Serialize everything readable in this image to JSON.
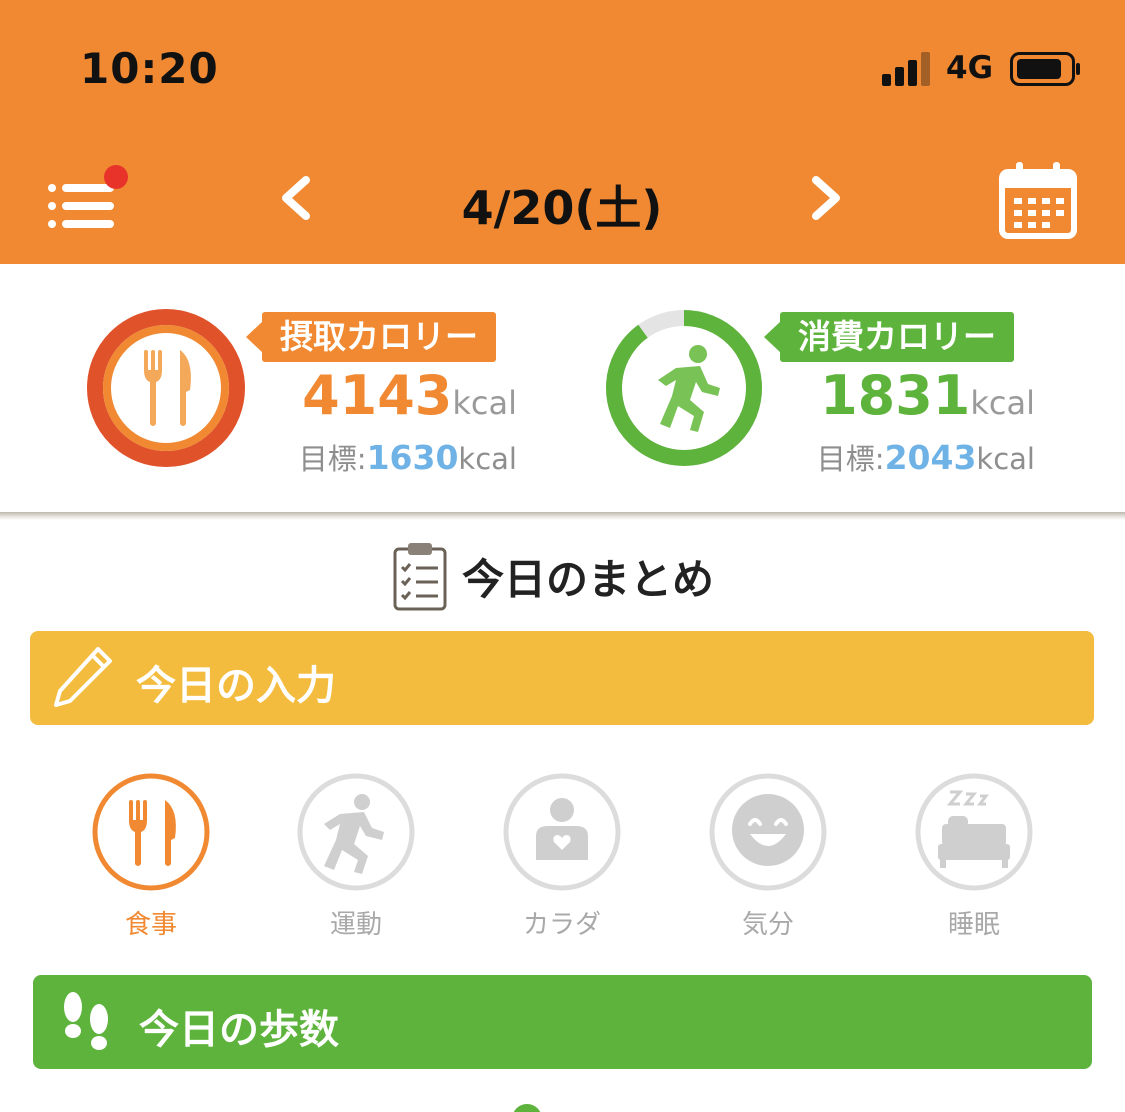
{
  "status_bar": {
    "time": "10:20",
    "network": "4G"
  },
  "header": {
    "date": "4/20(土)",
    "has_notification": true
  },
  "calories": {
    "intake": {
      "label": "摂取カロリー",
      "value": "4143",
      "unit": "kcal",
      "goal_prefix": "目標:",
      "goal_value": "1630",
      "goal_unit": "kcal"
    },
    "burned": {
      "label": "消費カロリー",
      "value": "1831",
      "unit": "kcal",
      "goal_prefix": "目標:",
      "goal_value": "2043",
      "goal_unit": "kcal",
      "progress": 0.9
    }
  },
  "summary": {
    "title": "今日のまとめ"
  },
  "input_section": {
    "title": "今日の入力"
  },
  "categories": [
    {
      "label": "食事",
      "icon": "fork-knife-icon",
      "active": true
    },
    {
      "label": "運動",
      "icon": "running-icon",
      "active": false
    },
    {
      "label": "カラダ",
      "icon": "body-icon",
      "active": false
    },
    {
      "label": "気分",
      "icon": "smile-icon",
      "active": false
    },
    {
      "label": "睡眠",
      "icon": "sleep-icon",
      "active": false
    }
  ],
  "steps_section": {
    "title": "今日の歩数"
  },
  "colors": {
    "orange": "#f08932",
    "green": "#5db33c",
    "yellow": "#f4bc3f",
    "blue": "#6fb3e6",
    "gray": "#d6d6d6"
  }
}
